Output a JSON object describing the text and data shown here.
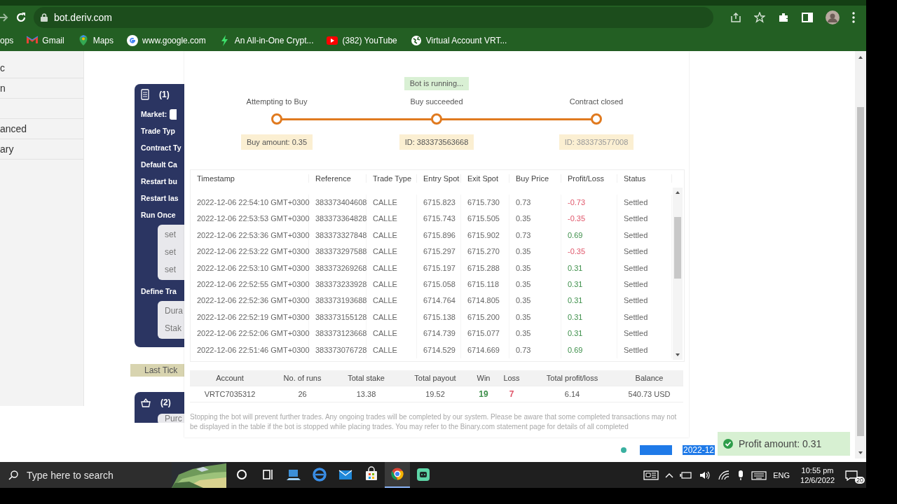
{
  "browser": {
    "url": "bot.deriv.com",
    "bookmarks": [
      "ops",
      "Gmail",
      "Maps",
      "www.google.com",
      "An All-in-One Crypt...",
      "(382) YouTube",
      "Virtual Account VRT..."
    ]
  },
  "sidebar": {
    "items": [
      "c",
      "n",
      "anced",
      "ary"
    ]
  },
  "workspace": {
    "block_1": {
      "number": "(1)",
      "fields": [
        "Market:",
        "Trade Typ",
        "Contract Ty",
        "Default Ca",
        "Restart bu",
        "Restart las",
        "Run Once"
      ],
      "run_once_items": [
        "set",
        "set",
        "set"
      ],
      "define_label": "Define Tra",
      "define_items": [
        "Dura",
        "Stak"
      ]
    },
    "last_tick": "Last Tick",
    "block_2": {
      "number": "(2)",
      "items": [
        "Purc"
      ]
    }
  },
  "run_panel": {
    "status": "Bot is running...",
    "steps": [
      {
        "label": "Attempting to Buy",
        "tag": "Buy amount: 0.35"
      },
      {
        "label": "Buy succeeded",
        "tag": "ID: 383373563668"
      },
      {
        "label": "Contract closed",
        "tag": "ID: 383373577008"
      }
    ],
    "table": {
      "columns": [
        "Timestamp",
        "Reference",
        "Trade Type",
        "Entry Spot",
        "Exit Spot",
        "Buy Price",
        "Profit/Loss",
        "Status"
      ],
      "rows": [
        {
          "timestamp": "2022-12-06 22:54:10 GMT+0300",
          "reference": "383373404608",
          "trade_type": "CALLE",
          "entry_spot": "6715.823",
          "exit_spot": "6715.730",
          "buy_price": "0.73",
          "profit_loss": "-0.73",
          "color": "#e0566a",
          "status": "Settled"
        },
        {
          "timestamp": "2022-12-06 22:53:53 GMT+0300",
          "reference": "383373364828",
          "trade_type": "CALLE",
          "entry_spot": "6715.743",
          "exit_spot": "6715.505",
          "buy_price": "0.35",
          "profit_loss": "-0.35",
          "color": "#e0566a",
          "status": "Settled"
        },
        {
          "timestamp": "2022-12-06 22:53:36 GMT+0300",
          "reference": "383373327848",
          "trade_type": "CALLE",
          "entry_spot": "6715.896",
          "exit_spot": "6715.902",
          "buy_price": "0.73",
          "profit_loss": "0.69",
          "color": "#3d8f4a",
          "status": "Settled"
        },
        {
          "timestamp": "2022-12-06 22:53:22 GMT+0300",
          "reference": "383373297588",
          "trade_type": "CALLE",
          "entry_spot": "6715.297",
          "exit_spot": "6715.270",
          "buy_price": "0.35",
          "profit_loss": "-0.35",
          "color": "#e0566a",
          "status": "Settled"
        },
        {
          "timestamp": "2022-12-06 22:53:10 GMT+0300",
          "reference": "383373269268",
          "trade_type": "CALLE",
          "entry_spot": "6715.197",
          "exit_spot": "6715.288",
          "buy_price": "0.35",
          "profit_loss": "0.31",
          "color": "#3d8f4a",
          "status": "Settled"
        },
        {
          "timestamp": "2022-12-06 22:52:55 GMT+0300",
          "reference": "383373233928",
          "trade_type": "CALLE",
          "entry_spot": "6715.058",
          "exit_spot": "6715.118",
          "buy_price": "0.35",
          "profit_loss": "0.31",
          "color": "#3d8f4a",
          "status": "Settled"
        },
        {
          "timestamp": "2022-12-06 22:52:36 GMT+0300",
          "reference": "383373193688",
          "trade_type": "CALLE",
          "entry_spot": "6714.764",
          "exit_spot": "6714.805",
          "buy_price": "0.35",
          "profit_loss": "0.31",
          "color": "#3d8f4a",
          "status": "Settled"
        },
        {
          "timestamp": "2022-12-06 22:52:19 GMT+0300",
          "reference": "383373155128",
          "trade_type": "CALLE",
          "entry_spot": "6715.138",
          "exit_spot": "6715.200",
          "buy_price": "0.35",
          "profit_loss": "0.31",
          "color": "#3d8f4a",
          "status": "Settled"
        },
        {
          "timestamp": "2022-12-06 22:52:06 GMT+0300",
          "reference": "383373123668",
          "trade_type": "CALLE",
          "entry_spot": "6714.739",
          "exit_spot": "6715.077",
          "buy_price": "0.35",
          "profit_loss": "0.31",
          "color": "#3d8f4a",
          "status": "Settled"
        },
        {
          "timestamp": "2022-12-06 22:51:46 GMT+0300",
          "reference": "383373076728",
          "trade_type": "CALLE",
          "entry_spot": "6714.529",
          "exit_spot": "6714.669",
          "buy_price": "0.73",
          "profit_loss": "0.69",
          "color": "#3d8f4a",
          "status": "Settled"
        }
      ]
    },
    "summary": {
      "columns": [
        {
          "label": "Account",
          "value": "VRTC7035312"
        },
        {
          "label": "No. of runs",
          "value": "26"
        },
        {
          "label": "Total stake",
          "value": "13.38"
        },
        {
          "label": "Total payout",
          "value": "19.52"
        },
        {
          "label": "Win",
          "value": "19",
          "color": "#3d8f4a"
        },
        {
          "label": "Loss",
          "value": "7",
          "color": "#e0566a"
        },
        {
          "label": "Total profit/loss",
          "value": "6.14"
        },
        {
          "label": "Balance",
          "value": "540.73 USD"
        }
      ]
    },
    "disclaimer": "Stopping the bot will prevent further trades. Any ongoing trades will be completed by our system. Please be aware that some completed transactions may not be displayed in the table if the bot is stopped while placing trades. You may refer to the Binary.com statement page for details of all completed"
  },
  "footer": {
    "selected_text": "2022-12"
  },
  "toast": {
    "message": "Profit amount: 0.31"
  },
  "taskbar": {
    "search_placeholder": "Type here to search",
    "language": "ENG",
    "time": "10:55 pm",
    "date": "12/6/2022",
    "notifications": "20"
  }
}
